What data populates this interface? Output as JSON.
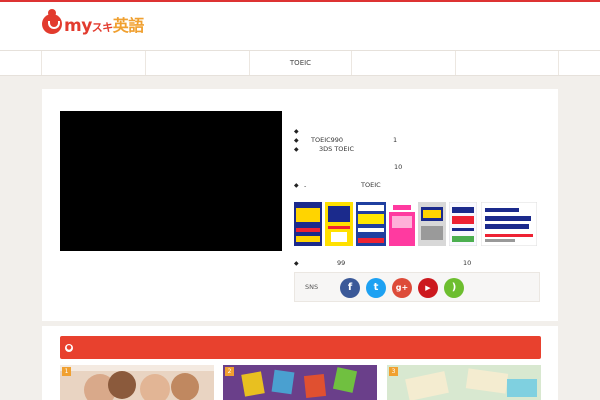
{
  "brand": {
    "logo_mark": "my",
    "logo_kana": "スキ",
    "logo_kanji": "英語"
  },
  "nav": {
    "items": [
      "",
      "",
      "TOEIC",
      "",
      ""
    ]
  },
  "info": {
    "bullet_glyph": "◆",
    "lines": [
      {
        "texts": [
          {
            "t": "TOEIC990"
          },
          {
            "t": "1"
          }
        ]
      },
      {
        "texts": [
          {
            "t": "3DS  TOEIC"
          }
        ]
      },
      {
        "texts": [
          {
            "t": "10"
          }
        ]
      },
      {
        "texts": [
          {
            "t": "-"
          },
          {
            "t": "TOEIC"
          }
        ]
      },
      {
        "texts": [
          {
            "t": "99"
          },
          {
            "t": "10"
          }
        ]
      }
    ]
  },
  "books": [
    {
      "title": "超速",
      "sub": "",
      "bg": "#1b2a8c",
      "fg": "#ffd400"
    },
    {
      "title": "パズル英単語",
      "sub": "",
      "bg": "#ffe000",
      "fg": "#1b2a8c"
    },
    {
      "title": "TOEIC TEST",
      "sub": "",
      "bg": "#1f3fa0",
      "fg": "#ffe800"
    },
    {
      "title": "",
      "sub": "",
      "bg": "#ff3aa0",
      "fg": "#ffffff"
    },
    {
      "title": "超速",
      "sub": "",
      "bg": "#cfcfcf",
      "fg": "#1b2a8c"
    },
    {
      "title": "TOEICテスト",
      "sub": "",
      "bg": "#f8f8ff",
      "fg": "#1b2a8c"
    },
    {
      "title": "TOEICテスト",
      "sub": "超速トレーニング",
      "bg": "#ffffff",
      "fg": "#1b2a8c"
    }
  ],
  "sns": {
    "label": "SNS",
    "buttons": [
      {
        "name": "facebook-icon",
        "glyph": "f",
        "color": "#3b5998"
      },
      {
        "name": "twitter-icon",
        "glyph": "t",
        "color": "#1da1f2"
      },
      {
        "name": "google-plus-icon",
        "glyph": "g+",
        "color": "#dd4b39"
      },
      {
        "name": "youtube-icon",
        "glyph": "▶",
        "color": "#cc181e"
      },
      {
        "name": "rss-icon",
        "glyph": ")",
        "color": "#6dbe2f"
      }
    ]
  },
  "section": {
    "dot": "●",
    "thumbs": [
      {
        "num": "1"
      },
      {
        "num": "2"
      },
      {
        "num": "3"
      }
    ]
  }
}
